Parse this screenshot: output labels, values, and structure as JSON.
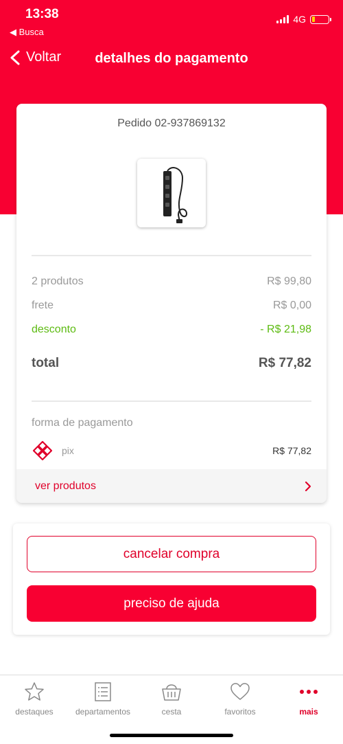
{
  "status_bar": {
    "time": "13:38",
    "back_app": "◀ Busca",
    "network": "4G",
    "battery_level": 0.2,
    "battery_color": "#ffd400"
  },
  "header": {
    "back_label": "Voltar",
    "title": "detalhes do pagamento"
  },
  "colors": {
    "brand_red": "#f80032",
    "discount_green": "#5dbb12"
  },
  "order": {
    "number_label": "Pedido 02-937869132",
    "product_image": "power-strip-product-icon",
    "summary": {
      "products_label": "2 produtos",
      "products_value": "R$ 99,80",
      "shipping_label": "frete",
      "shipping_value": "R$ 0,00",
      "discount_label": "desconto",
      "discount_value": "- R$ 21,98",
      "total_label": "total",
      "total_value": "R$ 77,82"
    },
    "payment": {
      "section_label": "forma de pagamento",
      "method_icon": "pix-icon",
      "method_name": "pix",
      "method_value": "R$ 77,82"
    },
    "see_products_label": "ver produtos"
  },
  "actions": {
    "cancel_label": "cancelar compra",
    "help_label": "preciso de ajuda"
  },
  "tabbar": {
    "tabs": [
      {
        "label": "destaques",
        "icon": "star-icon"
      },
      {
        "label": "departamentos",
        "icon": "list-icon"
      },
      {
        "label": "cesta",
        "icon": "basket-icon"
      },
      {
        "label": "favoritos",
        "icon": "heart-icon"
      },
      {
        "label": "mais",
        "icon": "more-dots-icon"
      }
    ],
    "active": "mais"
  }
}
